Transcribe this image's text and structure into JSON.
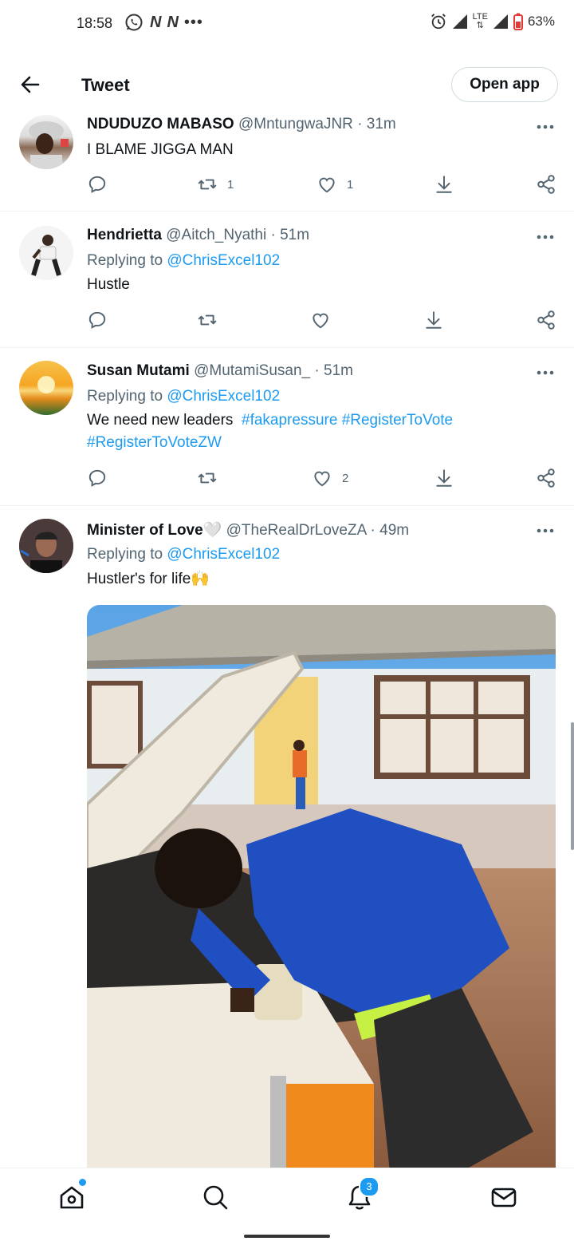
{
  "status_bar": {
    "time": "18:58",
    "network_letter": "N",
    "lte": "LTE",
    "battery": "63%"
  },
  "topbar": {
    "title": "Tweet",
    "open_app": "Open app"
  },
  "tweets": [
    {
      "name": "NDUDUZO MABASO",
      "handle": "@MntungwaJNR",
      "time": "· 31m",
      "replying_label": "",
      "replying_to": "",
      "text": "I BLAME JIGGA MAN",
      "hashtags": [],
      "retweets": "1",
      "likes": "1"
    },
    {
      "name": "Hendrietta",
      "handle": "@Aitch_Nyathi",
      "time": "· 51m",
      "replying_label": "Replying to",
      "replying_to": "@ChrisExcel102",
      "text": "Hustle",
      "hashtags": [],
      "retweets": "",
      "likes": ""
    },
    {
      "name": "Susan Mutami",
      "handle": "@MutamiSusan_",
      "time": "· 51m",
      "replying_label": "Replying to",
      "replying_to": "@ChrisExcel102",
      "text": "We need new leaders",
      "hashtags": [
        "#fakapressure",
        "#RegisterToVote",
        "#RegisterToVoteZW"
      ],
      "retweets": "",
      "likes": "2"
    },
    {
      "name": "Minister of Love",
      "name_emoji": "🤍",
      "handle": "@TheRealDrLoveZA",
      "time": "· 49m",
      "replying_label": "Replying to",
      "replying_to": "@ChrisExcel102",
      "text": "Hustler's for life",
      "text_emoji": "🙌",
      "hashtags": []
    }
  ],
  "bottom_nav": {
    "notifications_badge": "3"
  },
  "colors": {
    "accent": "#1d9bf0",
    "text": "#0f1419",
    "secondary": "#536471",
    "divider": "#eff3f4"
  },
  "icons": [
    "back-arrow-icon",
    "more-icon",
    "reply-icon",
    "retweet-icon",
    "like-icon",
    "download-icon",
    "share-icon",
    "home-icon",
    "search-icon",
    "notifications-icon",
    "messages-icon"
  ]
}
